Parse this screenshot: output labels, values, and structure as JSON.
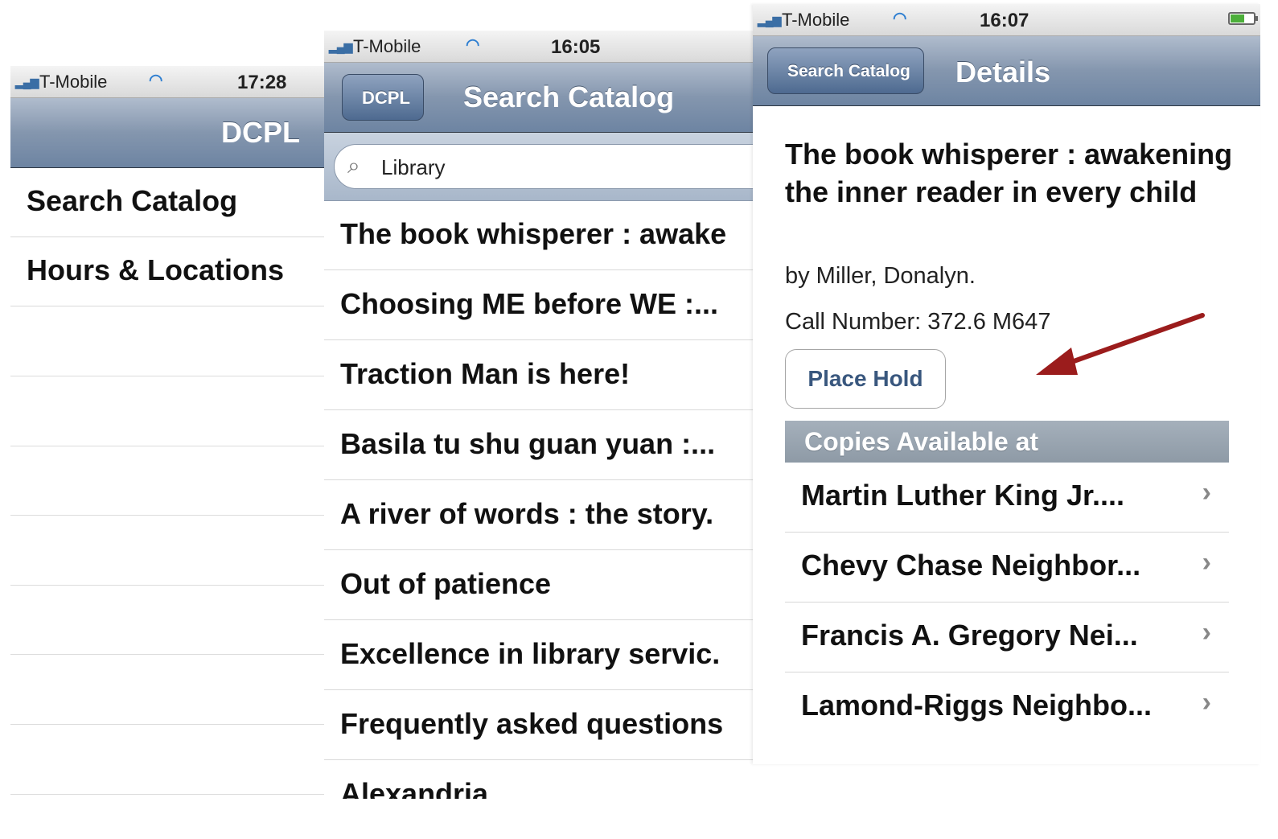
{
  "screen1": {
    "status": {
      "carrier": "T-Mobile",
      "time": "17:28"
    },
    "nav_title": "DCPL",
    "menu": [
      {
        "label": "Search Catalog"
      },
      {
        "label": "Hours & Locations"
      }
    ]
  },
  "screen2": {
    "status": {
      "carrier": "T-Mobile",
      "time": "16:05"
    },
    "back_label": "DCPL",
    "nav_title": "Search Catalog",
    "search": {
      "value": "Library"
    },
    "results": [
      {
        "title": "The book whisperer : awake"
      },
      {
        "title": "Choosing ME before WE :..."
      },
      {
        "title": "Traction Man is here!"
      },
      {
        "title": "Basila tu shu guan yuan :..."
      },
      {
        "title": "A river of words : the story."
      },
      {
        "title": "Out of patience"
      },
      {
        "title": "Excellence in library servic."
      },
      {
        "title": "Frequently asked questions"
      },
      {
        "title": "Alexandria"
      }
    ]
  },
  "screen3": {
    "status": {
      "carrier": "T-Mobile",
      "time": "16:07",
      "battery_level": 0.6
    },
    "back_label": "Search Catalog",
    "nav_title": "Details",
    "book": {
      "title": "The book whisperer : awakening the inner reader in every child",
      "author": "by  Miller, Donalyn.",
      "call_number": "Call Number: 372.6 M647"
    },
    "hold_button": "Place Hold",
    "section_header": "Copies Available at",
    "locations": [
      {
        "name": "Martin Luther King Jr...."
      },
      {
        "name": "Chevy Chase Neighbor..."
      },
      {
        "name": "Francis A. Gregory Nei..."
      },
      {
        "name": "Lamond-Riggs Neighbo..."
      }
    ]
  },
  "colors": {
    "nav_bar": "#7b90ab",
    "arrow": "#9b1c1c",
    "accent_text": "#39577e"
  },
  "icons": [
    "signal-bars-icon",
    "wifi-icon",
    "battery-icon",
    "search-icon",
    "chevron-right-icon",
    "red-arrow-annotation"
  ]
}
